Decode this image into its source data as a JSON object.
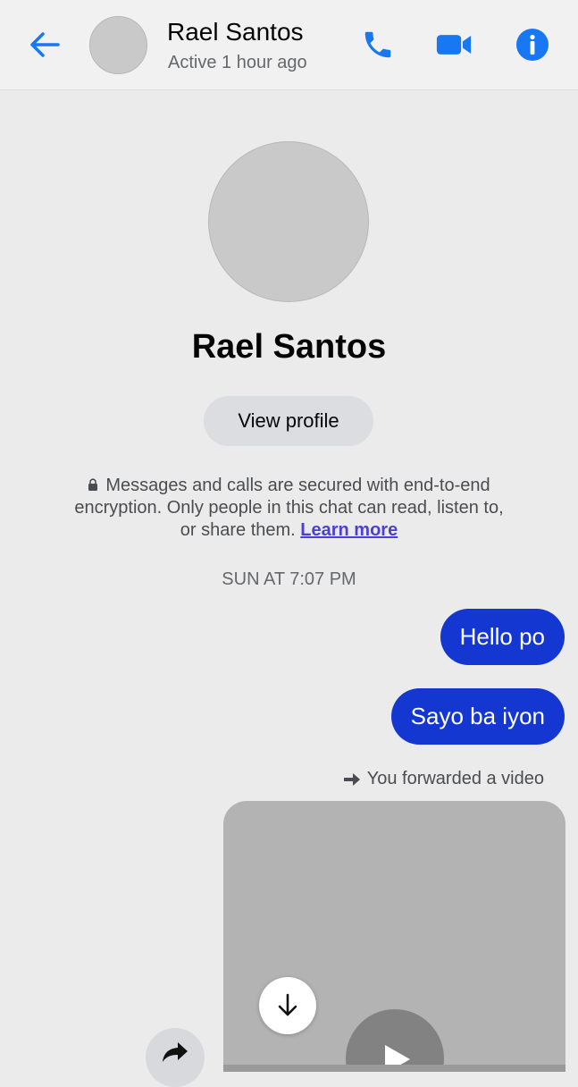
{
  "header": {
    "contact_name": "Rael Santos",
    "status": "Active 1 hour ago",
    "icons": {
      "back": "back-arrow-icon",
      "call": "phone-icon",
      "video": "video-camera-icon",
      "info": "info-icon"
    }
  },
  "profile": {
    "name": "Rael Santos",
    "view_profile_label": "View profile"
  },
  "encryption": {
    "text": "Messages and calls are secured with end-to-end encryption. Only people in this chat can read, listen to, or share them.",
    "learn_more": "Learn more"
  },
  "thread": {
    "timestamp": "SUN AT 7:07 PM",
    "messages": [
      {
        "text": "Hello po"
      },
      {
        "text": "Sayo ba iyon"
      }
    ],
    "forward_note": "You forwarded a video"
  },
  "colors": {
    "accent": "#1877f2",
    "bubble": "#1537d1",
    "link": "#4b3fd6",
    "background": "#ebebeb"
  }
}
